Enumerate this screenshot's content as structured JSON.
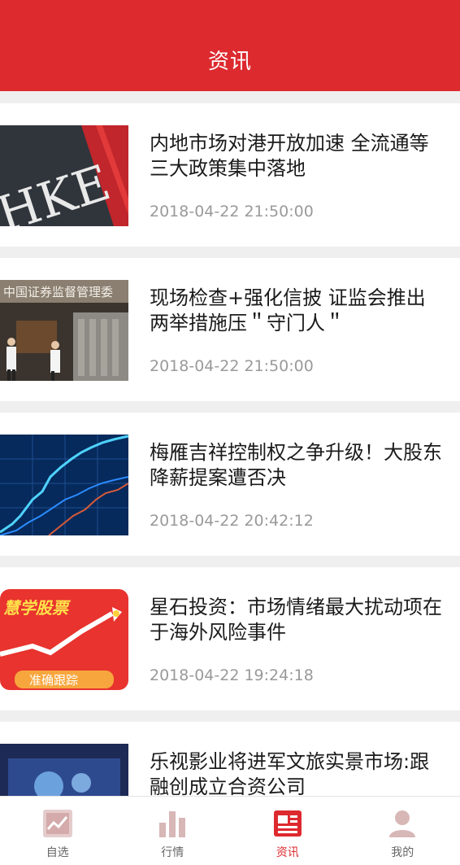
{
  "header": {
    "title": "资讯"
  },
  "news": [
    {
      "title": "内地市场对港开放加速 全流通等三大政策集中落地",
      "time": "2018-04-22 21:50:00"
    },
    {
      "title": "现场检查+强化信披 证监会推出两举措施压＂守门人＂",
      "time": "2018-04-22 21:50:00"
    },
    {
      "title": "梅雁吉祥控制权之争升级！大股东降薪提案遭否决",
      "time": "2018-04-22 20:42:12"
    },
    {
      "title": "星石投资：市场情绪最大扰动项在于海外风险事件",
      "time": "2018-04-22 19:24:18"
    },
    {
      "title": "乐视影业将进军文旅实景市场:跟融创成立合资公司",
      "time": ""
    }
  ],
  "thumbs": {
    "hke_text": "HKE",
    "csrc_text": "中国证券监督管理委",
    "ad_title": "慧学股票",
    "ad_button": "准确跟踪"
  },
  "tabs": [
    {
      "label": "自选",
      "icon": "watchlist-chart-icon",
      "active": false
    },
    {
      "label": "行情",
      "icon": "bar-chart-icon",
      "active": false
    },
    {
      "label": "资讯",
      "icon": "news-icon",
      "active": true
    },
    {
      "label": "我的",
      "icon": "user-icon",
      "active": false
    }
  ],
  "colors": {
    "brand": "#dd2a2f",
    "inactive_icon": "#d8b7b7",
    "background": "#efefef"
  }
}
